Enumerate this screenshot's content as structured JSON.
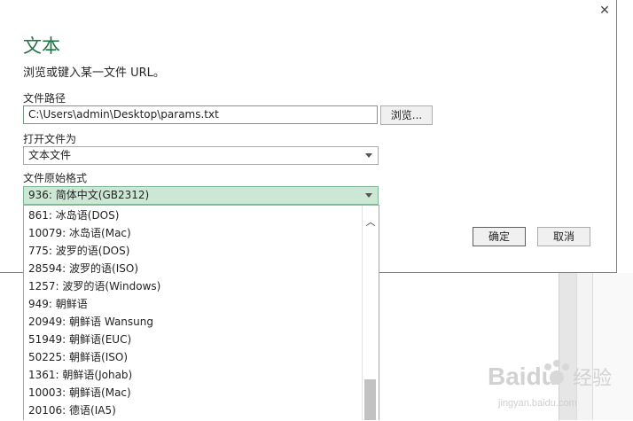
{
  "dialog": {
    "title": "文本",
    "subtitle": "浏览或键入某一文件 URL。",
    "close_icon": "close-icon",
    "file_path": {
      "label": "文件路径",
      "value": "C:\\Users\\admin\\Desktop\\params.txt",
      "browse_label": "浏览..."
    },
    "open_as": {
      "label": "打开文件为",
      "selected": "文本文件"
    },
    "file_origin": {
      "label": "文件原始格式",
      "selected": "936: 简体中文(GB2312)",
      "options": [
        "861: 冰岛语(DOS)",
        "10079: 冰岛语(Mac)",
        "775: 波罗的语(DOS)",
        "28594: 波罗的语(ISO)",
        "1257: 波罗的语(Windows)",
        "949: 朝鲜语",
        "20949: 朝鲜语 Wansung",
        "51949: 朝鲜语(EUC)",
        "50225: 朝鲜语(ISO)",
        "1361: 朝鲜语(Johab)",
        "10003: 朝鲜语(Mac)",
        "20106: 德语(IA5)"
      ]
    },
    "ok_label": "确定",
    "cancel_label": "取消"
  },
  "watermark": {
    "brand": "Baidu",
    "brand_cn": "经验",
    "url": "jingyan.baidu.com"
  },
  "colors": {
    "accent": "#217346",
    "selected_bg": "#cce8d4"
  }
}
